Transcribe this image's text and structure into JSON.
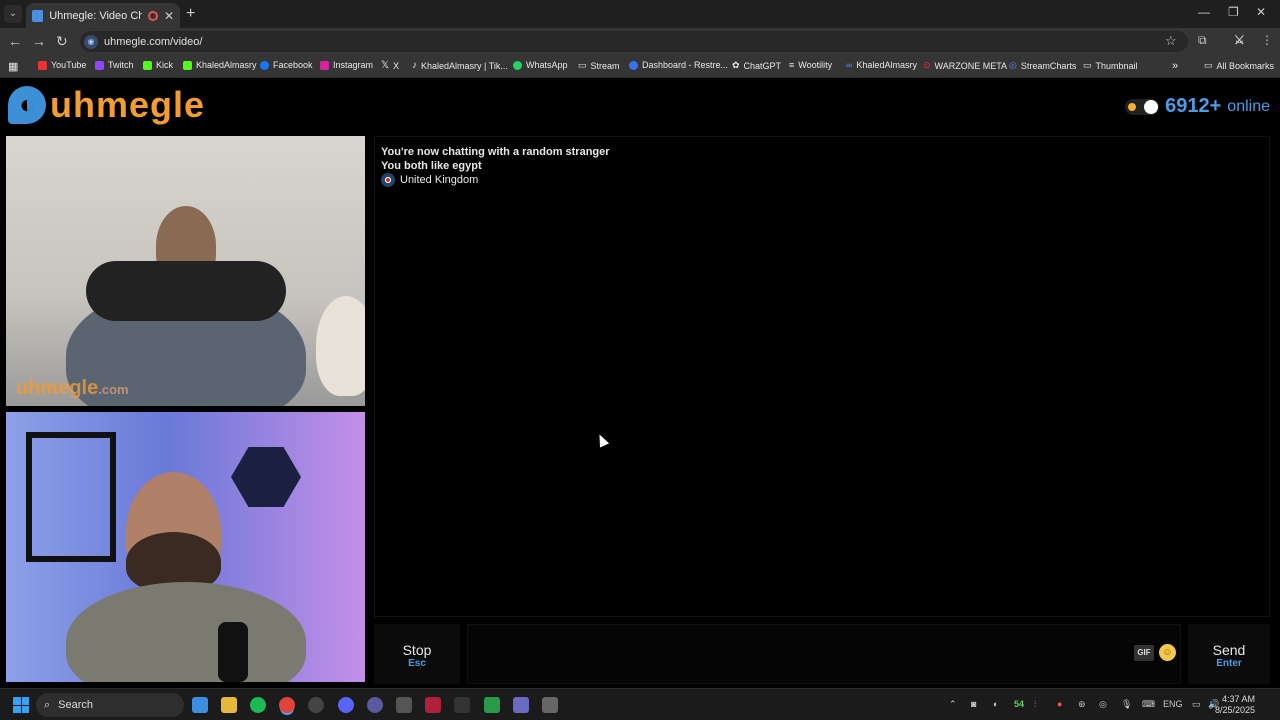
{
  "browser": {
    "tab_title": "Uhmegle: Video Chat | Ome",
    "url": "uhmegle.com/video/",
    "bookmarks": [
      {
        "label": "YouTube",
        "color": "#e33"
      },
      {
        "label": "Twitch",
        "color": "#9146ff"
      },
      {
        "label": "Kick",
        "color": "#53fc18"
      },
      {
        "label": "KhaledAlmasry",
        "color": "#53fc18"
      },
      {
        "label": "Facebook",
        "color": "#1877f2"
      },
      {
        "label": "Instagram",
        "color": "#d6249f"
      },
      {
        "label": "X",
        "color": "#ffffff"
      },
      {
        "label": "KhaledAlmasry | Tik...",
        "color": "#ffffff"
      },
      {
        "label": "WhatsApp",
        "color": "#25d366"
      },
      {
        "label": "Stream",
        "color": "#cccccc"
      },
      {
        "label": "Dashboard - Restre...",
        "color": "#3b6ff5"
      },
      {
        "label": "ChatGPT",
        "color": "#cccccc"
      },
      {
        "label": "Wootility",
        "color": "#cccccc"
      },
      {
        "label": "KhaledAlmasry",
        "color": "#5b8cf5"
      },
      {
        "label": "WARZONE META",
        "color": "#e34"
      },
      {
        "label": "StreamCharts",
        "color": "#5b8cf5"
      },
      {
        "label": "Thumbnail",
        "color": "#cccccc"
      }
    ],
    "all_bookmarks": "All Bookmarks"
  },
  "site": {
    "logo_text": "uhmegle",
    "online_count": "6912+",
    "online_label": "online",
    "watermark": "uhmegle",
    "watermark_suffix": ".com"
  },
  "chat": {
    "status": "You're now chatting with a random stranger",
    "interest": "You both like egypt",
    "country": "United Kingdom"
  },
  "controls": {
    "stop_label": "Stop",
    "stop_key": "Esc",
    "gif_label": "GIF",
    "send_label": "Send",
    "send_key": "Enter"
  },
  "taskbar": {
    "search_label": "Search",
    "temp": "54",
    "lang": "ENG",
    "time": "4:37 AM",
    "date": "8/25/2025"
  }
}
